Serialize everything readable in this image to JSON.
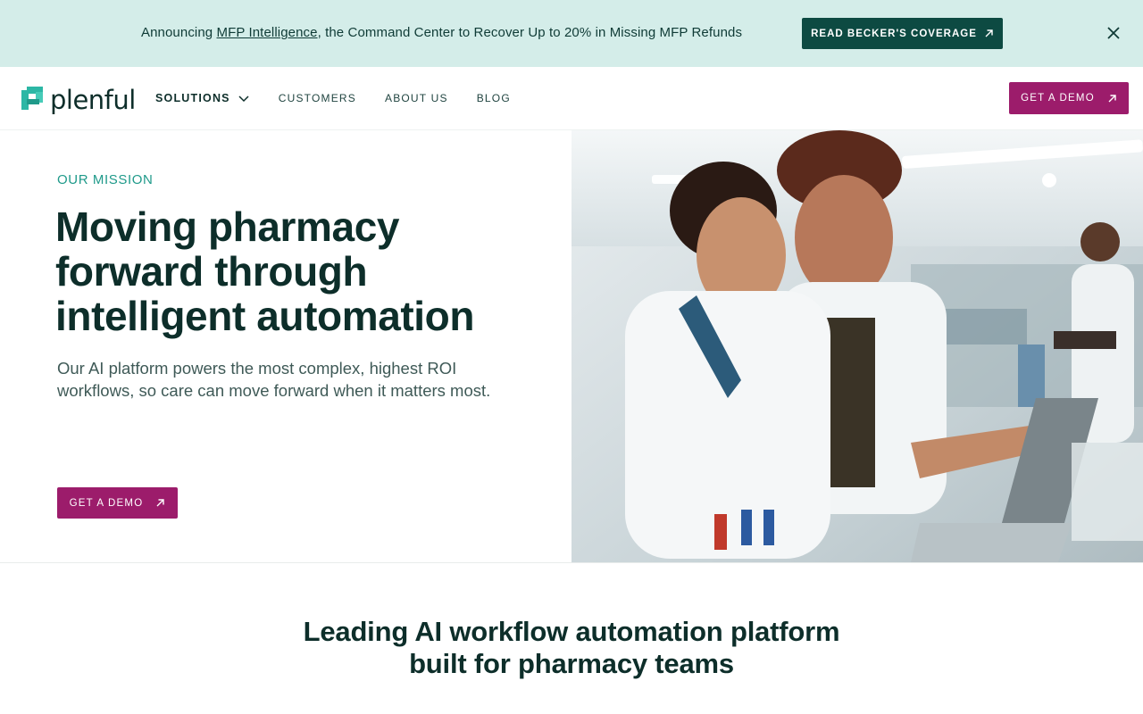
{
  "announcement": {
    "prefix": "Announcing ",
    "link_text": "MFP Intelligence",
    "suffix": ", the Command Center to Recover Up to 20% in Missing MFP Refunds",
    "button_label": "READ BECKER'S COVERAGE"
  },
  "header": {
    "logo_text": "plenful",
    "nav": [
      {
        "label": "SOLUTIONS"
      },
      {
        "label": "CUSTOMERS"
      },
      {
        "label": "ABOUT US"
      },
      {
        "label": "BLOG"
      }
    ],
    "cta_label": "GET A DEMO"
  },
  "hero": {
    "eyebrow": "OUR MISSION",
    "title": "Moving pharmacy forward through intelligent automation",
    "subtitle": "Our AI platform powers the most complex, highest ROI workflows, so care can move forward when it matters most.",
    "cta_label": "GET A DEMO"
  },
  "section": {
    "title_line1": "Leading AI workflow automation platform",
    "title_line2": "built for pharmacy teams"
  },
  "colors": {
    "brand_teal": "#1f9a8a",
    "dark_green": "#0d4a42",
    "magenta_cta": "#9c1c6b",
    "announce_bg": "#d4ede9"
  },
  "icons": [
    "arrow-up-right-icon",
    "close-icon",
    "chevron-down-icon",
    "plenful-logo-icon"
  ]
}
